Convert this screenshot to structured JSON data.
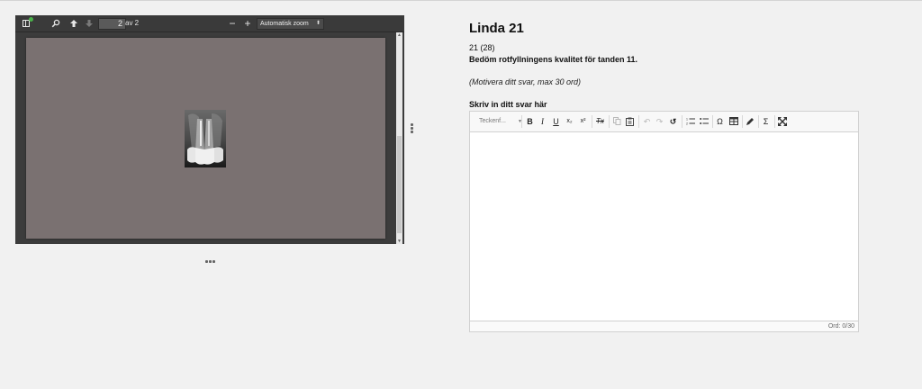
{
  "viewer": {
    "current_page": "2",
    "page_of": "av 2",
    "zoom_value": "Automatisk zoom",
    "icons": {
      "sidebar": "sidebar-toggle-icon",
      "search": "search-icon",
      "prev": "arrow-up-icon",
      "next": "arrow-down-icon",
      "zoom_out": "minus-icon",
      "zoom_in": "plus-icon"
    }
  },
  "question": {
    "title": "Linda 21",
    "number": "21 (28)",
    "text": "Bedöm rotfyllningens kvalitet för tanden 11.",
    "hint": "(Motivera ditt svar, max 30 ord)",
    "answer_label": "Skriv in ditt svar här"
  },
  "editor": {
    "font_placeholder": "Teckenf...",
    "buttons": {
      "bold": "B",
      "italic": "I",
      "underline": "U",
      "subscript": "x₂",
      "superscript": "x²",
      "remove_format": "Tx",
      "special_char": "Ω",
      "sum": "Σ"
    },
    "word_count": "Ord: 0/30"
  },
  "colors": {
    "toolbar_bg": "#3a3a3a",
    "page_bg": "#7a7171",
    "notify_dot": "#4ab34a"
  }
}
